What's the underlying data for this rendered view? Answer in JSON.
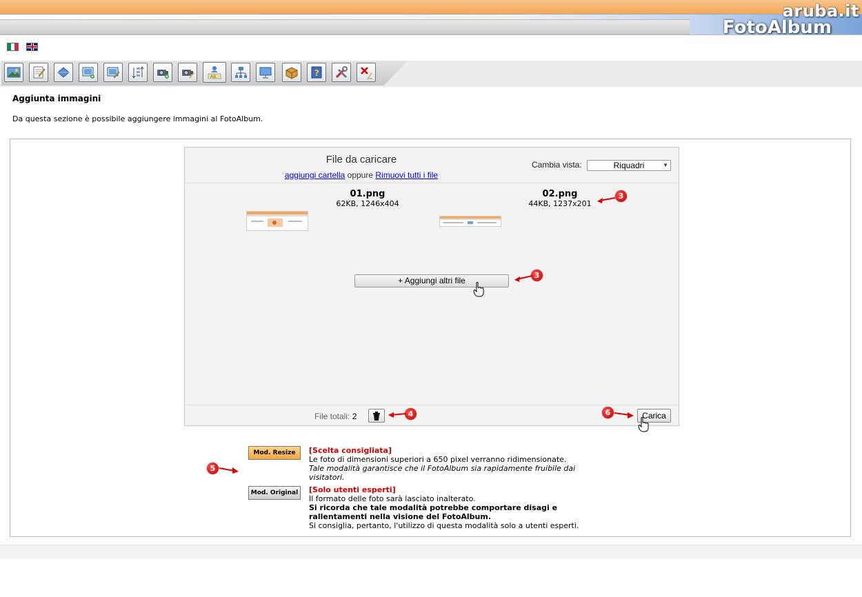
{
  "brand": {
    "top_logo": "aruba.it",
    "product_logo": "FotoAlbum"
  },
  "languages": [
    {
      "code": "it",
      "icon": "italian-flag-icon"
    },
    {
      "code": "en",
      "icon": "british-flag-icon"
    }
  ],
  "toolbar": {
    "icons": [
      "photo-edit-icon",
      "notepad-icon",
      "diamond-icon",
      "image-add-icon",
      "image-edit-icon",
      "sort-icon",
      "camera-add-icon",
      "camera-edit-icon",
      "users-icon",
      "network-icon",
      "monitor-icon",
      "package-icon",
      "help-icon",
      "tools-icon",
      "delete-icon"
    ]
  },
  "page": {
    "title": "Aggiunta immagini",
    "description": "Da questa sezione è possibile aggiungere immagini al FotoAlbum."
  },
  "uploader": {
    "title": "File da caricare",
    "add_folder_link": "aggiungi cartella",
    "or_text": " oppure ",
    "remove_all_link": "Rimuovi tutti i file",
    "view_label": "Cambia vista:",
    "view_value": "Riquadri",
    "files": [
      {
        "name": "01.png",
        "meta": "62KB, 1246x404"
      },
      {
        "name": "02.png",
        "meta": "44KB, 1237x201"
      }
    ],
    "add_more_button": "+ Aggiungi altri file",
    "total_label": "File totali:",
    "total_count": "2",
    "upload_button": "Carica"
  },
  "callouts": [
    "3",
    "3",
    "4",
    "5",
    "6"
  ],
  "modes": {
    "resize": {
      "button": "Mod. Resize",
      "heading": "[Scelta consigliata]",
      "line1": "Le foto di dimensioni superiori a 650 pixel verranno ridimensionate.",
      "line2": "Tale modalità garantisce che il FotoAlbum sia rapidamente fruibile dai visitatori."
    },
    "original": {
      "button": "Mod. Original",
      "heading": "[Solo utenti esperti]",
      "line1": "Il formato delle foto sarà lasciato inalterato.",
      "line2": "Si ricorda che tale modalità potrebbe comportare disagi e rallentamenti nella visione del FotoAlbum.",
      "line3": "Si consiglia, pertanto, l'utilizzo di questa modalità solo a utenti esperti."
    }
  },
  "colors": {
    "accent_orange": "#f4a85a",
    "callout_red": "#d00000",
    "link_blue": "#0000ee"
  }
}
